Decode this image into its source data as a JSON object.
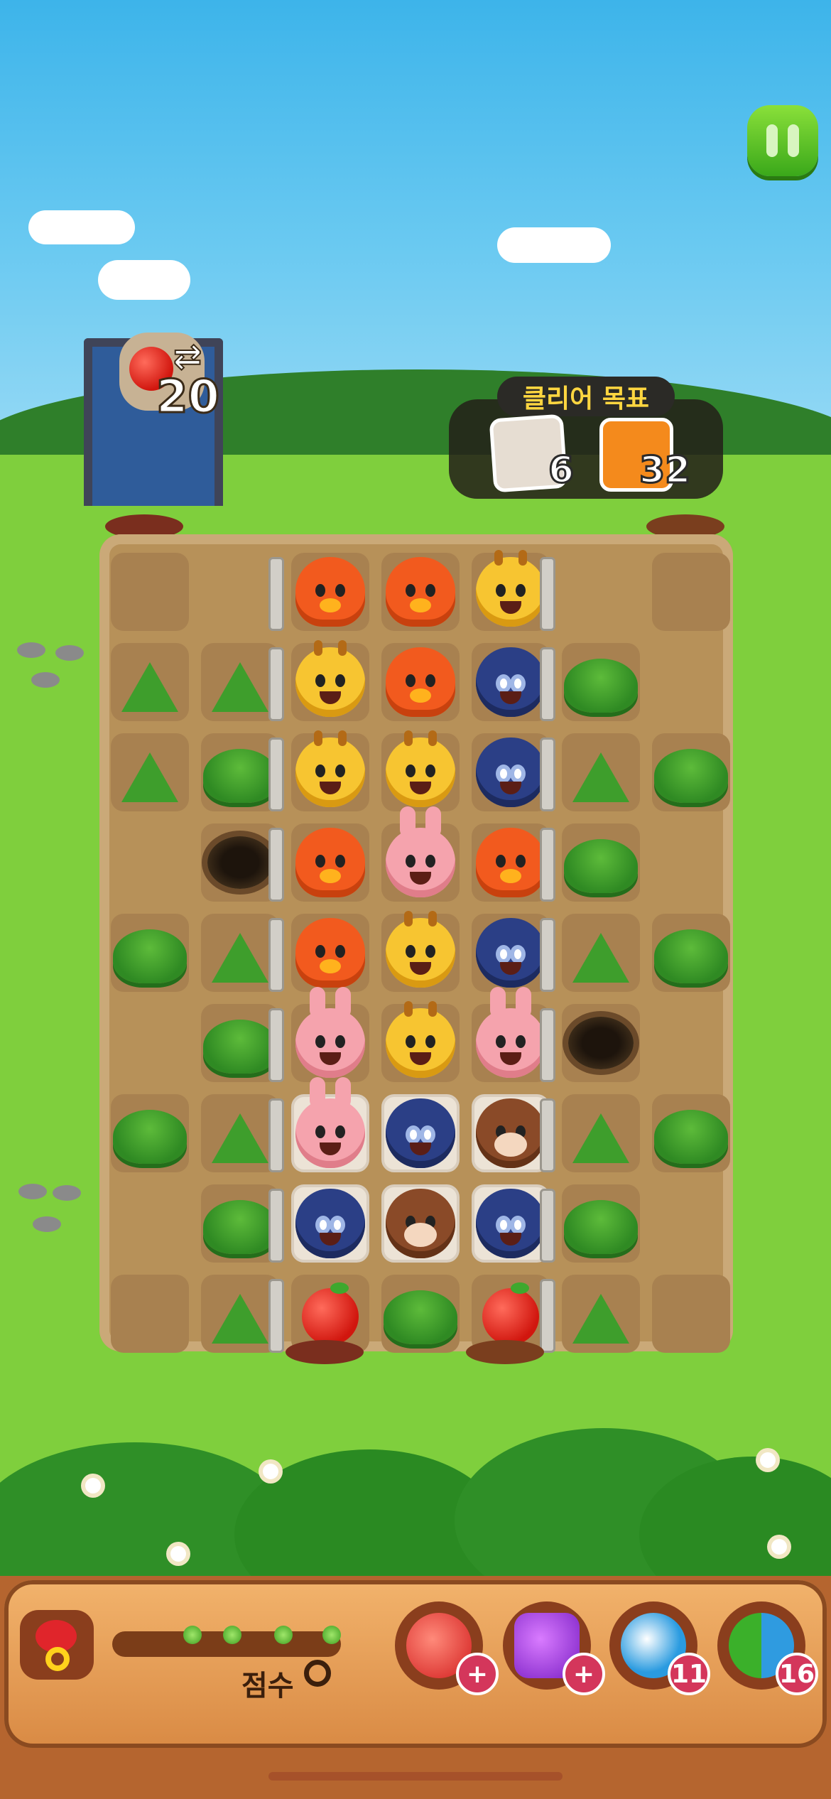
{
  "hud": {
    "moves_left": "20",
    "swap_symbol": "⇄",
    "goal_title": "클리어 목표",
    "goals": [
      {
        "name": "stone-tile",
        "count": "6"
      },
      {
        "name": "orange-tile",
        "count": "32"
      }
    ]
  },
  "bottom": {
    "score_label": "점수",
    "score_value": "0",
    "boosters": [
      {
        "name": "hammer",
        "count": "+"
      },
      {
        "name": "magic-hammer",
        "count": "+"
      },
      {
        "name": "shuffle-ball",
        "count": "11"
      },
      {
        "name": "swap-arrows",
        "count": "16"
      }
    ]
  },
  "board": {
    "rows": [
      [
        "dirt",
        "none",
        "chicken",
        "chicken",
        "giraffe",
        "none",
        "dirt"
      ],
      [
        "tuft",
        "tuft",
        "giraffe",
        "chicken",
        "wolf",
        "bush",
        "none"
      ],
      [
        "tuft",
        "bush",
        "giraffe",
        "giraffe",
        "wolf",
        "tuft",
        "bush"
      ],
      [
        "none",
        "hole",
        "chicken",
        "rabbit",
        "chicken",
        "bush",
        "none"
      ],
      [
        "bush",
        "tuft",
        "chicken",
        "giraffe",
        "wolf",
        "tuft",
        "bush"
      ],
      [
        "none",
        "bush",
        "rabbit",
        "giraffe",
        "rabbit",
        "hole",
        "none"
      ],
      [
        "bush",
        "tuft",
        "rabbit",
        "wolf",
        "bear",
        "tuft",
        "bush"
      ],
      [
        "none",
        "bush",
        "wolf",
        "bear",
        "wolf",
        "bush",
        "none"
      ],
      [
        "dirt",
        "tuft",
        "apple",
        "bush",
        "apple",
        "tuft",
        "dirt"
      ]
    ],
    "light_cells": [
      [
        6,
        2
      ],
      [
        6,
        3
      ],
      [
        6,
        4
      ],
      [
        7,
        2
      ],
      [
        7,
        3
      ],
      [
        7,
        4
      ]
    ]
  },
  "colors": {
    "sky": "#3db4ea",
    "grass": "#7fcf3d",
    "pause": "#5cc22a",
    "board": "#b79159"
  }
}
